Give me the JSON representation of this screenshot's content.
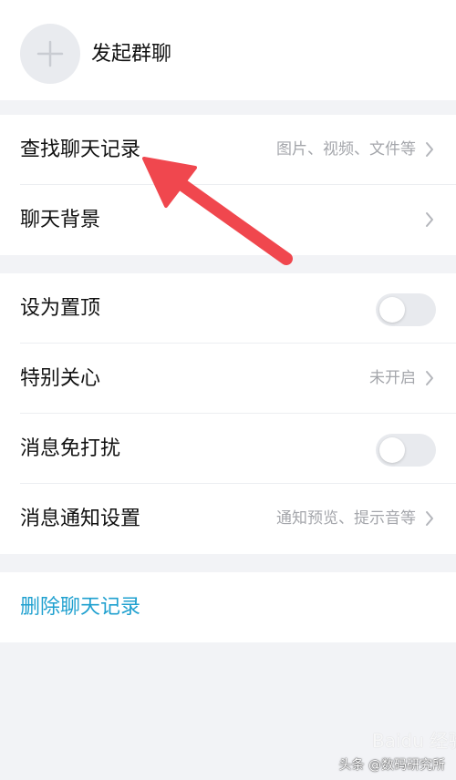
{
  "header": {
    "start_group_chat_label": "发起群聊",
    "add_icon": "plus-icon"
  },
  "chat_section": {
    "rows": [
      {
        "label": "查找聊天记录",
        "value": "图片、视频、文件等",
        "icon": "chevron-right-icon"
      },
      {
        "label": "聊天背景",
        "value": "",
        "icon": "chevron-right-icon"
      }
    ]
  },
  "settings_section": {
    "rows": [
      {
        "label": "设为置顶",
        "control": "toggle",
        "on": false
      },
      {
        "label": "特别关心",
        "value": "未开启",
        "icon": "chevron-right-icon"
      },
      {
        "label": "消息免打扰",
        "control": "toggle",
        "on": false
      },
      {
        "label": "消息通知设置",
        "value": "通知预览、提示音等",
        "icon": "chevron-right-icon"
      }
    ]
  },
  "danger_section": {
    "delete_chat_history_label": "删除聊天记录"
  },
  "annotation": {
    "arrow_color": "#f0474e",
    "points_to": "查找聊天记录"
  },
  "watermarks": {
    "baidu": "Baidu 经验",
    "credit": "头条 @数码研究所"
  },
  "colors": {
    "background": "#f2f3f6",
    "panel": "#ffffff",
    "secondary_text": "#a4a6ab",
    "link_text": "#1fa0cf",
    "toggle_off": "#e8eaee"
  }
}
